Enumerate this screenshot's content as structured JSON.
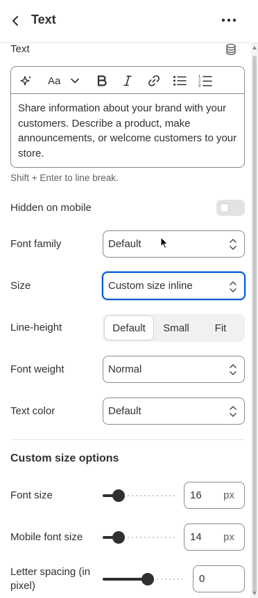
{
  "header": {
    "title": "Text",
    "back_icon": "chevron-left-icon",
    "more_icon": "ellipsis-icon"
  },
  "text_setting": {
    "label": "Text",
    "source_icon": "database-icon",
    "toolbar_icons": [
      "sparkle-icon",
      "font-size-icon",
      "chevron-down-icon",
      "bold-icon",
      "italic-icon",
      "link-icon",
      "bullet-list-icon",
      "numbered-list-icon"
    ],
    "content": "Share information about your brand with your customers. Describe a product, make announcements, or welcome customers to your store.",
    "hint": "Shift + Enter to line break."
  },
  "hidden_on_mobile": {
    "label": "Hidden on mobile",
    "checked": false
  },
  "font_family": {
    "label": "Font family",
    "value": "Default"
  },
  "size": {
    "label": "Size",
    "value": "Custom size inline"
  },
  "line_height": {
    "label": "Line-height",
    "options": [
      "Default",
      "Small",
      "Fit"
    ],
    "selected": "Default"
  },
  "font_weight": {
    "label": "Font weight",
    "value": "Normal"
  },
  "text_color": {
    "label": "Text color",
    "value": "Default"
  },
  "custom_size": {
    "title": "Custom size options",
    "font_size": {
      "label": "Font size",
      "value": "16",
      "unit": "px",
      "slider_fraction": 0.16
    },
    "mobile_font_size": {
      "label": "Mobile font size",
      "value": "14",
      "unit": "px",
      "slider_fraction": 0.16
    },
    "letter_spacing": {
      "label": "Letter spacing (in pixel)",
      "value": "0",
      "slider_fraction": 0.55
    }
  },
  "colors": {
    "accent": "#005bd3",
    "text": "#303030",
    "muted": "#616161",
    "border": "#8a8a8a"
  }
}
